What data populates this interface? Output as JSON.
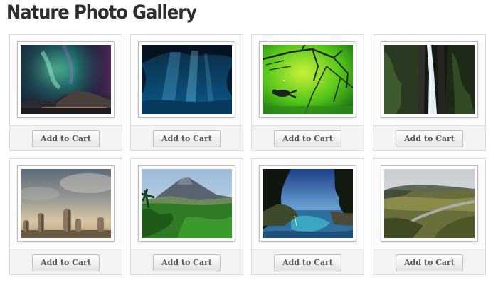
{
  "page": {
    "title": "Nature Photo Gallery"
  },
  "gallery": {
    "items": [
      {
        "photo": "aurora-over-mountains",
        "button_label": "Add to Cart"
      },
      {
        "photo": "underwater-cave-light-beams",
        "button_label": "Add to Cart"
      },
      {
        "photo": "diver-in-green-water",
        "button_label": "Add to Cart"
      },
      {
        "photo": "forest-waterfall",
        "button_label": "Add to Cart"
      },
      {
        "photo": "stone-sculptures-beach",
        "button_label": "Add to Cart"
      },
      {
        "photo": "volcano-tropical-forest",
        "button_label": "Add to Cart"
      },
      {
        "photo": "coastal-cove-waterfall",
        "button_label": "Add to Cart"
      },
      {
        "photo": "river-valley-highlands",
        "button_label": "Add to Cart"
      }
    ]
  }
}
